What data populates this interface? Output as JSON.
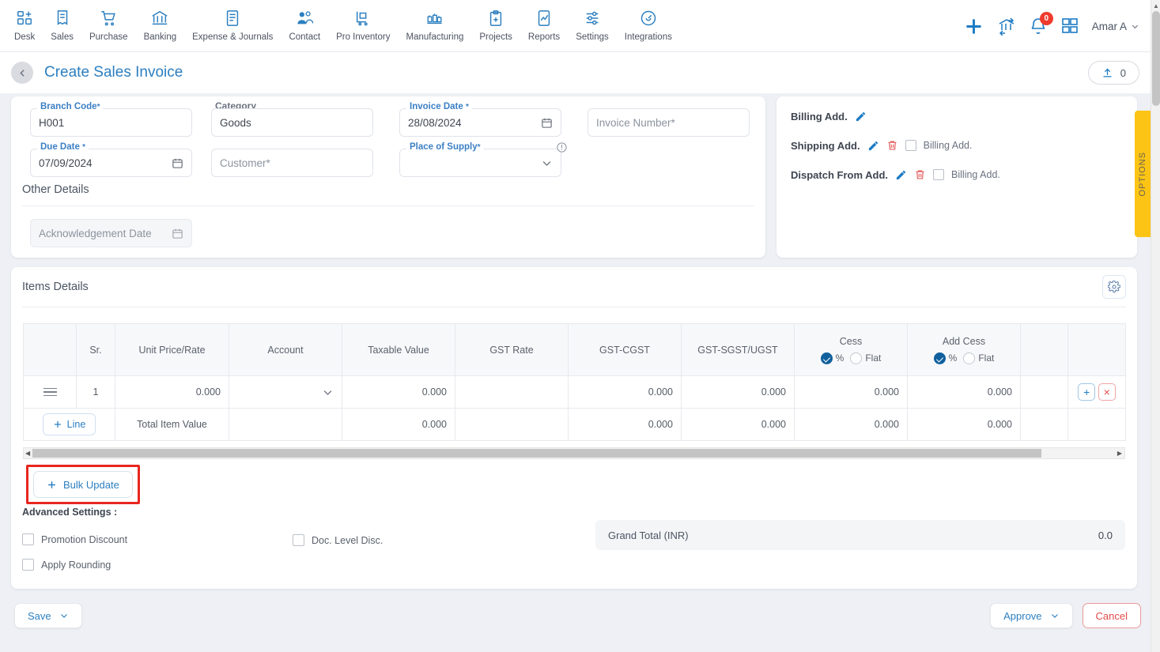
{
  "nav": {
    "items": [
      {
        "label": "Desk",
        "icon": "desk-icon"
      },
      {
        "label": "Sales",
        "icon": "sales-icon"
      },
      {
        "label": "Purchase",
        "icon": "purchase-cart-icon"
      },
      {
        "label": "Banking",
        "icon": "bank-icon"
      },
      {
        "label": "Expense & Journals",
        "icon": "journal-icon"
      },
      {
        "label": "Contact",
        "icon": "contact-people-icon"
      },
      {
        "label": "Pro Inventory",
        "icon": "inventory-trolley-icon"
      },
      {
        "label": "Manufacturing",
        "icon": "manufacturing-icon"
      },
      {
        "label": "Projects",
        "icon": "projects-clipboard-icon"
      },
      {
        "label": "Reports",
        "icon": "reports-chart-icon"
      },
      {
        "label": "Settings",
        "icon": "settings-sliders-icon"
      },
      {
        "label": "Integrations",
        "icon": "integrations-plug-icon"
      }
    ],
    "right": {
      "add_icon": "plus-icon",
      "bank_icon": "bank-transfer-icon",
      "bell_icon": "bell-icon",
      "notification_count": "0",
      "apps_icon": "apps-grid-icon",
      "user_name": "Amar A",
      "user_chevron": "chevron-down-icon"
    }
  },
  "titlebar": {
    "back_icon": "chevron-left-icon",
    "title": "Create Sales Invoice",
    "upload_icon": "upload-icon",
    "upload_count": "0"
  },
  "form": {
    "branch_code": {
      "label": "Branch Code",
      "required": "*",
      "value": "H001"
    },
    "category": {
      "label": "Category",
      "value": "Goods"
    },
    "invoice_date": {
      "label": "Invoice Date",
      "required": "*",
      "value": "28/08/2024",
      "icon": "calendar-icon"
    },
    "invoice_number": {
      "placeholder": "Invoice Number",
      "required": "*"
    },
    "due_date": {
      "label": "Due Date",
      "required": "*",
      "value": "07/09/2024",
      "icon": "calendar-icon"
    },
    "customer": {
      "placeholder": "Customer",
      "required": "*"
    },
    "place_of_supply": {
      "label": "Place of Supply",
      "required": "*",
      "value": "",
      "info_icon": "info-icon",
      "chevron": "chevron-down-icon"
    },
    "other_details_title": "Other Details",
    "acknowledgement_date": {
      "placeholder": "Acknowledgement Date",
      "icon": "calendar-icon"
    }
  },
  "addresses": {
    "rows": [
      {
        "label": "Billing Add.",
        "edit_icon": "pencil-icon",
        "has_delete": false,
        "has_checkbox": false,
        "checkbox_label": ""
      },
      {
        "label": "Shipping Add.",
        "edit_icon": "pencil-icon",
        "has_delete": true,
        "has_checkbox": true,
        "checkbox_label": "Billing Add."
      },
      {
        "label": "Dispatch From Add.",
        "edit_icon": "pencil-icon",
        "has_delete": true,
        "has_checkbox": true,
        "checkbox_label": "Billing Add."
      }
    ],
    "delete_icon": "trash-icon"
  },
  "options_tab": {
    "label": "OPTIONS"
  },
  "items": {
    "title": "Items Details",
    "gear_icon": "gear-icon",
    "columns": [
      {
        "label": "",
        "key": "handle"
      },
      {
        "label": "Sr.",
        "key": "sr"
      },
      {
        "label": "Unit Price/Rate",
        "key": "unit_price"
      },
      {
        "label": "Account",
        "key": "account"
      },
      {
        "label": "Taxable Value",
        "key": "taxable_value"
      },
      {
        "label": "GST Rate",
        "key": "gst_rate"
      },
      {
        "label": "GST-CGST",
        "key": "gst_cgst"
      },
      {
        "label": "GST-SGST/UGST",
        "key": "gst_sgst"
      },
      {
        "label": "Cess",
        "key": "cess",
        "toggle": {
          "opt1": "%",
          "opt2": "Flat",
          "selected": "%"
        }
      },
      {
        "label": "Add Cess",
        "key": "add_cess",
        "toggle": {
          "opt1": "%",
          "opt2": "Flat",
          "selected": "%"
        }
      },
      {
        "label": "",
        "key": "spacer"
      },
      {
        "label": "",
        "key": "actions"
      }
    ],
    "rows": [
      {
        "handle_icon": "drag-handle-icon",
        "sr": "1",
        "unit_price": "0.000",
        "account": "",
        "account_chevron": "chevron-down-icon",
        "taxable_value": "0.000",
        "gst_rate": "",
        "gst_cgst": "0.000",
        "gst_sgst": "0.000",
        "cess": "0.000",
        "add_cess": "0.000",
        "add_icon": "plus-icon",
        "remove_icon": "close-x-icon"
      }
    ],
    "total_row": {
      "add_line_label": "Line",
      "add_line_icon": "plus-icon",
      "label": "Total Item Value",
      "taxable_value": "0.000",
      "gst_cgst": "0.000",
      "gst_sgst": "0.000",
      "cess": "0.000",
      "add_cess": "0.000"
    },
    "scrollbar": {
      "left_arrow": "caret-left-icon",
      "right_arrow": "caret-right-icon"
    }
  },
  "bulk_update": {
    "label": "Bulk Update",
    "icon": "plus-icon",
    "highlight_color": "#e8261f"
  },
  "advanced": {
    "title": "Advanced Settings :",
    "promotion_discount": {
      "label": "Promotion Discount",
      "checked": false
    },
    "apply_rounding": {
      "label": "Apply Rounding",
      "checked": false
    },
    "doc_level_disc": {
      "label": "Doc. Level Disc.",
      "checked": false
    }
  },
  "grand_total": {
    "label": "Grand Total (INR)",
    "value": "0.0"
  },
  "footer": {
    "save": {
      "label": "Save",
      "chevron": "chevron-down-icon"
    },
    "approve": {
      "label": "Approve",
      "chevron": "chevron-down-icon"
    },
    "cancel": {
      "label": "Cancel"
    }
  }
}
